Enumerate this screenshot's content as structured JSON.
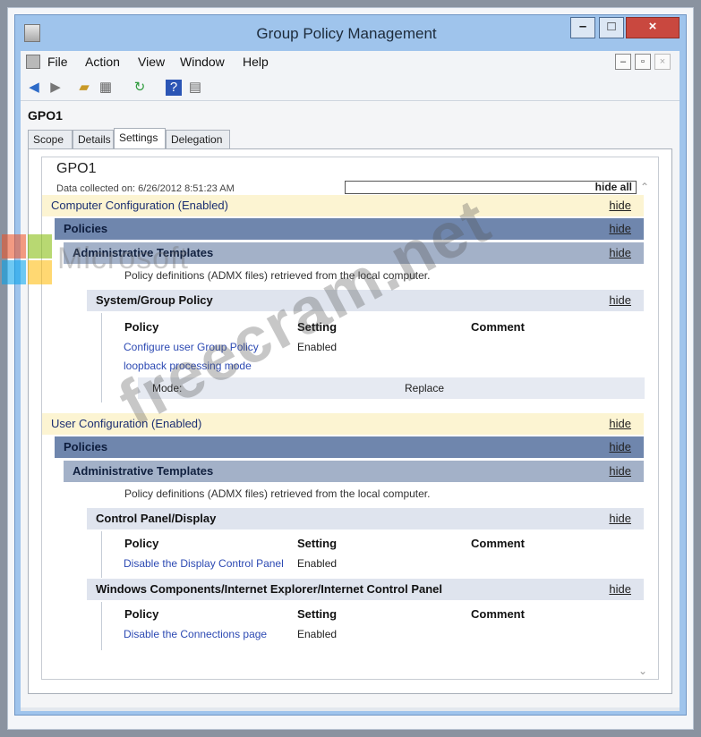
{
  "window": {
    "title": "Group Policy Management",
    "buttons": {
      "minimize": "–",
      "maximize": "□",
      "close": "×"
    }
  },
  "menubar": {
    "items": [
      "File",
      "Action",
      "View",
      "Window",
      "Help"
    ],
    "mdi_buttons": [
      "–",
      "▫",
      "×"
    ]
  },
  "toolbar": {
    "icons": [
      "back-arrow-icon",
      "forward-arrow-icon",
      "folder-up-icon",
      "show-hide-tree-icon",
      "refresh-icon",
      "help-icon",
      "properties-icon"
    ]
  },
  "gpo_heading": "GPO1",
  "tabs": [
    "Scope",
    "Details",
    "Settings",
    "Delegation"
  ],
  "active_tab": "Settings",
  "report": {
    "title": "GPO1",
    "collected": "Data collected on: 6/26/2012 8:51:23 AM",
    "hide_all": "hide all",
    "computer": {
      "heading": "Computer Configuration (Enabled)",
      "hide": "hide",
      "policies": "Policies",
      "admin_templates": "Administrative Templates",
      "admx_note": "Policy definitions (ADMX files) retrieved from the local computer.",
      "section": "System/Group Policy",
      "columns": [
        "Policy",
        "Setting",
        "Comment"
      ],
      "rows": [
        {
          "policy_line1": "Configure user Group Policy",
          "policy_line2": "loopback processing mode",
          "setting": "Enabled"
        }
      ],
      "mode_label": "Mode:",
      "mode_value": "Replace"
    },
    "user": {
      "heading": "User Configuration (Enabled)",
      "hide": "hide",
      "policies": "Policies",
      "admin_templates": "Administrative Templates",
      "admx_note": "Policy definitions (ADMX files) retrieved from the local computer.",
      "section1": "Control Panel/Display",
      "columns": [
        "Policy",
        "Setting",
        "Comment"
      ],
      "row1": {
        "policy": "Disable the Display Control Panel",
        "setting": "Enabled"
      },
      "section2": "Windows Components/Internet Explorer/Internet Control Panel",
      "row2": {
        "policy": "Disable the Connections page",
        "setting": "Enabled"
      }
    }
  },
  "watermarks": {
    "brand": "Microsoft",
    "site": "freecram.net"
  },
  "colors": {
    "config_bg": "#fcf4d2",
    "policies_bg": "#6f86ad",
    "admin_bg": "#a3b1c8",
    "section_bg": "#dfe4ee",
    "link": "#2d4ab3"
  }
}
